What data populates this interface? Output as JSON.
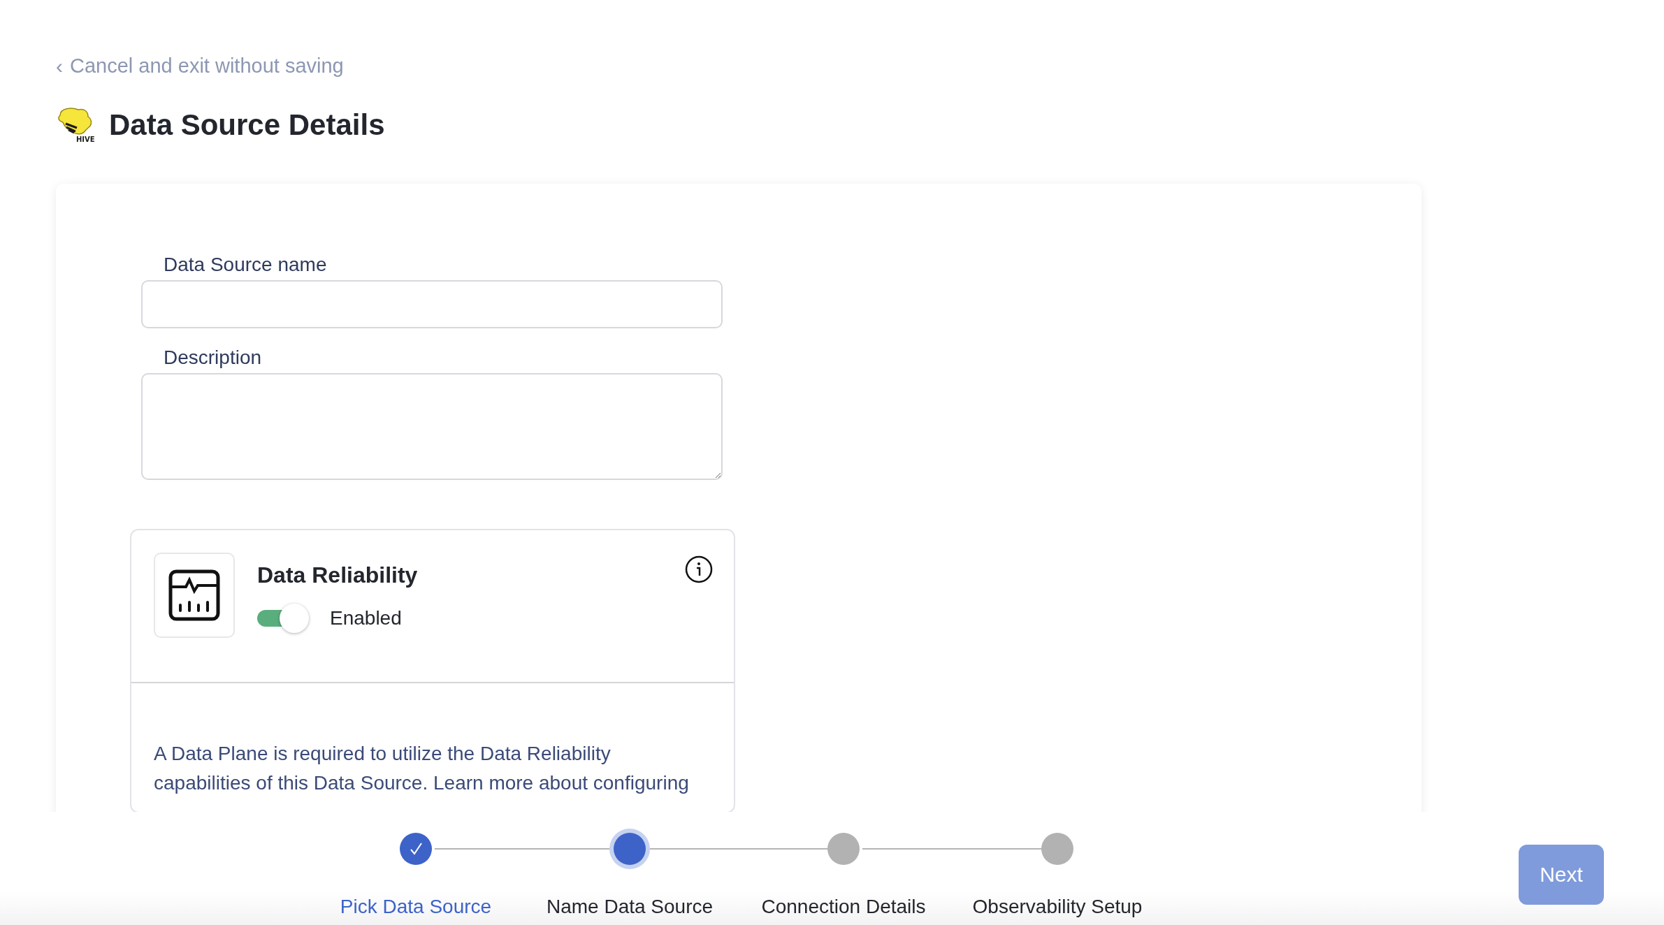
{
  "back_link": {
    "icon": "‹",
    "label": "Cancel and exit without saving"
  },
  "header": {
    "logo_text": "HIVE",
    "title": "Data Source Details"
  },
  "form": {
    "fields": [
      {
        "label": "Data Source name",
        "kind": "input"
      },
      {
        "label": "Description",
        "kind": "textarea"
      }
    ]
  },
  "reliability_card": {
    "title": "Data Reliability",
    "on": true,
    "toggle_label": "Enabled",
    "message": "A Data Plane is required to utilize the Data Reliability capabilities of this Data Source. Learn more about configuring"
  },
  "stepper": {
    "steps": [
      {
        "label": "Pick Data Source",
        "completed": true,
        "selected": false
      },
      {
        "label": "Name Data Source",
        "completed": false,
        "selected": true
      },
      {
        "label": "Connection Details",
        "completed": false,
        "selected": false
      },
      {
        "label": "Observability Setup",
        "completed": false,
        "selected": false
      }
    ]
  },
  "next_button": {
    "label": "Next",
    "disabled": true
  }
}
